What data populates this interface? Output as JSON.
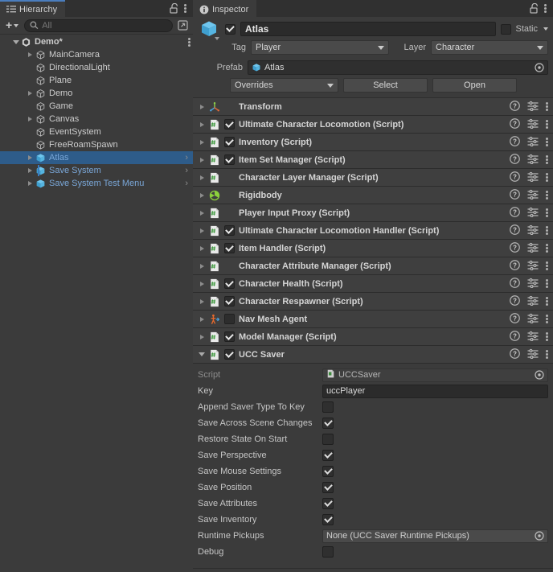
{
  "hierarchy": {
    "tab_label": "Hierarchy",
    "tab_icon": "hierarchy-icon",
    "lock_icon": "lock-open-icon",
    "menu_icon": "kebab-menu-icon",
    "toolbar": {
      "add_label": "+",
      "add_dropdown_icon": "chevron-down-icon",
      "search_icon": "search-icon",
      "search_placeholder": "All",
      "search_value": "",
      "right_button_icon": "open-in-window-icon"
    },
    "items": [
      {
        "label": "Demo*",
        "icon": "unity-scene-icon",
        "depth": 0,
        "twisty": "down",
        "selected": false,
        "prefab": false,
        "chevron": false,
        "scene": true,
        "modified_bar": false,
        "kebab": true
      },
      {
        "label": "MainCamera",
        "icon": "gameobject-icon",
        "depth": 1,
        "twisty": "right",
        "selected": false,
        "prefab": false,
        "chevron": false,
        "scene": false,
        "modified_bar": false,
        "kebab": false
      },
      {
        "label": "DirectionalLight",
        "icon": "gameobject-icon",
        "depth": 1,
        "twisty": "none",
        "selected": false,
        "prefab": false,
        "chevron": false,
        "scene": false,
        "modified_bar": false,
        "kebab": false
      },
      {
        "label": "Plane",
        "icon": "gameobject-icon",
        "depth": 1,
        "twisty": "none",
        "selected": false,
        "prefab": false,
        "chevron": false,
        "scene": false,
        "modified_bar": false,
        "kebab": false
      },
      {
        "label": "Demo",
        "icon": "gameobject-icon",
        "depth": 1,
        "twisty": "right",
        "selected": false,
        "prefab": false,
        "chevron": false,
        "scene": false,
        "modified_bar": false,
        "kebab": false
      },
      {
        "label": "Game",
        "icon": "gameobject-icon",
        "depth": 1,
        "twisty": "none",
        "selected": false,
        "prefab": false,
        "chevron": false,
        "scene": false,
        "modified_bar": false,
        "kebab": false
      },
      {
        "label": "Canvas",
        "icon": "gameobject-icon",
        "depth": 1,
        "twisty": "right",
        "selected": false,
        "prefab": false,
        "chevron": false,
        "scene": false,
        "modified_bar": false,
        "kebab": false
      },
      {
        "label": "EventSystem",
        "icon": "gameobject-icon",
        "depth": 1,
        "twisty": "none",
        "selected": false,
        "prefab": false,
        "chevron": false,
        "scene": false,
        "modified_bar": false,
        "kebab": false
      },
      {
        "label": "FreeRoamSpawn",
        "icon": "gameobject-icon",
        "depth": 1,
        "twisty": "none",
        "selected": false,
        "prefab": false,
        "chevron": false,
        "scene": false,
        "modified_bar": false,
        "kebab": false
      },
      {
        "label": "Atlas",
        "icon": "prefab-icon",
        "depth": 1,
        "twisty": "right",
        "selected": true,
        "prefab": true,
        "chevron": true,
        "scene": false,
        "modified_bar": false,
        "kebab": false
      },
      {
        "label": "Save System",
        "icon": "prefab-icon",
        "depth": 1,
        "twisty": "right",
        "selected": false,
        "prefab": true,
        "chevron": true,
        "scene": false,
        "modified_bar": true,
        "kebab": false
      },
      {
        "label": "Save System Test Menu",
        "icon": "prefab-icon",
        "depth": 1,
        "twisty": "right",
        "selected": false,
        "prefab": true,
        "chevron": true,
        "scene": false,
        "modified_bar": false,
        "kebab": false
      }
    ]
  },
  "inspector": {
    "tab_label": "Inspector",
    "tab_icon": "info-icon",
    "lock_icon": "lock-open-icon",
    "menu_icon": "kebab-menu-icon",
    "gameobject": {
      "icon": "prefab-cube-icon",
      "enabled": true,
      "name": "Atlas",
      "static_label": "Static",
      "static_checked": false,
      "static_dropdown_icon": "chevron-down-icon",
      "tag_label": "Tag",
      "tag_value": "Player",
      "layer_label": "Layer",
      "layer_value": "Character"
    },
    "prefab": {
      "label": "Prefab",
      "asset_icon": "prefab-icon",
      "asset_name": "Atlas",
      "target_picker_icon": "target-picker-icon",
      "overrides_label": "Overrides",
      "select_label": "Select",
      "open_label": "Open"
    },
    "components": [
      {
        "name": "Transform",
        "icon": "transform-icon",
        "expanded": false,
        "has_checkbox": false,
        "checked": false
      },
      {
        "name": "Ultimate Character Locomotion (Script)",
        "icon": "script-icon",
        "expanded": false,
        "has_checkbox": true,
        "checked": true
      },
      {
        "name": "Inventory (Script)",
        "icon": "script-icon",
        "expanded": false,
        "has_checkbox": true,
        "checked": true
      },
      {
        "name": "Item Set Manager (Script)",
        "icon": "script-icon",
        "expanded": false,
        "has_checkbox": true,
        "checked": true
      },
      {
        "name": "Character Layer Manager (Script)",
        "icon": "script-icon",
        "expanded": false,
        "has_checkbox": false,
        "checked": false
      },
      {
        "name": "Rigidbody",
        "icon": "rigidbody-icon",
        "expanded": false,
        "has_checkbox": false,
        "checked": false
      },
      {
        "name": "Player Input Proxy (Script)",
        "icon": "script-icon",
        "expanded": false,
        "has_checkbox": false,
        "checked": false
      },
      {
        "name": "Ultimate Character Locomotion Handler (Script)",
        "icon": "script-icon",
        "expanded": false,
        "has_checkbox": true,
        "checked": true
      },
      {
        "name": "Item Handler (Script)",
        "icon": "script-icon",
        "expanded": false,
        "has_checkbox": true,
        "checked": true
      },
      {
        "name": "Character Attribute Manager (Script)",
        "icon": "script-icon",
        "expanded": false,
        "has_checkbox": false,
        "checked": false
      },
      {
        "name": "Character Health (Script)",
        "icon": "script-icon",
        "expanded": false,
        "has_checkbox": true,
        "checked": true
      },
      {
        "name": "Character Respawner (Script)",
        "icon": "script-icon",
        "expanded": false,
        "has_checkbox": true,
        "checked": true
      },
      {
        "name": "Nav Mesh Agent",
        "icon": "navmesh-agent-icon",
        "expanded": false,
        "has_checkbox": true,
        "checked": false
      },
      {
        "name": "Model Manager (Script)",
        "icon": "script-icon",
        "expanded": false,
        "has_checkbox": true,
        "checked": true
      },
      {
        "name": "UCC Saver",
        "icon": "script-icon",
        "expanded": true,
        "has_checkbox": true,
        "checked": true
      }
    ],
    "component_row_icons": {
      "help_icon": "help-icon",
      "preset_icon": "preset-settings-icon",
      "menu_icon": "kebab-menu-icon"
    },
    "ucc_saver_properties": [
      {
        "label": "Script",
        "type": "object",
        "value": "UCCSaver",
        "icon": "cs-script-asset-icon",
        "readonly": true,
        "picker": true
      },
      {
        "label": "Key",
        "type": "text",
        "value": "uccPlayer"
      },
      {
        "label": "Append Saver Type To Key",
        "type": "checkbox",
        "checked": false
      },
      {
        "label": "Save Across Scene Changes",
        "type": "checkbox",
        "checked": true
      },
      {
        "label": "Restore State On Start",
        "type": "checkbox",
        "checked": false
      },
      {
        "label": "Save Perspective",
        "type": "checkbox",
        "checked": true
      },
      {
        "label": "Save Mouse Settings",
        "type": "checkbox",
        "checked": true
      },
      {
        "label": "Save Position",
        "type": "checkbox",
        "checked": true
      },
      {
        "label": "Save Attributes",
        "type": "checkbox",
        "checked": true
      },
      {
        "label": "Save Inventory",
        "type": "checkbox",
        "checked": true
      },
      {
        "label": "Runtime Pickups",
        "type": "object",
        "value": "None (UCC Saver Runtime Pickups)",
        "icon": "none",
        "readonly": false,
        "picker": true
      },
      {
        "label": "Debug",
        "type": "checkbox",
        "checked": false
      }
    ]
  },
  "colors": {
    "panel_bg": "#3b3b3b",
    "tabbar_bg": "#303030",
    "component_row_bg": "#3f3f3f",
    "selection_blue": "#2e5c8a",
    "prefab_text_blue": "#7aa7d8",
    "accent_tab_top": "#4a7dbd",
    "field_bg": "#2b2b2b",
    "button_bg": "#4a4a4a"
  }
}
